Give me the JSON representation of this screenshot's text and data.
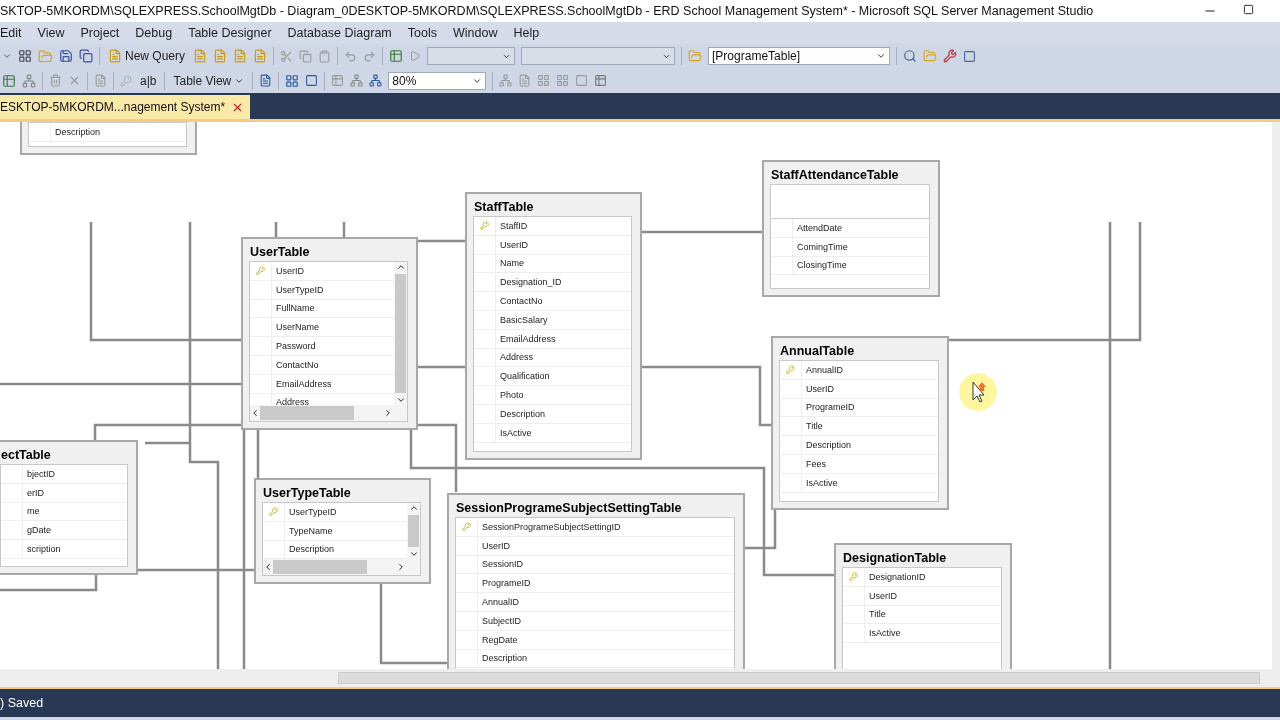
{
  "window": {
    "title": "SKTOP-5MKORDM\\SQLEXPRESS.SchoolMgtDb - Diagram_0DESKTOP-5MKORDM\\SQLEXPRESS.SchoolMgtDb - ERD School Management System* - Microsoft SQL Server Management Studio"
  },
  "menu": [
    "Edit",
    "View",
    "Project",
    "Debug",
    "Table Designer",
    "Database Diagram",
    "Tools",
    "Window",
    "Help"
  ],
  "toolbar": {
    "new_query": "New Query",
    "object_combo": "[ProgrameTable]"
  },
  "designer_toolbar": {
    "rename_glyph": "a|b",
    "table_view": "Table View",
    "zoom": "80%"
  },
  "tabs": [
    {
      "label": "ESKTOP-5MKORDM...nagement System*",
      "selected": true
    }
  ],
  "tables": [
    {
      "rows": [
        {
          "name": "Description",
          "pk": false
        }
      ],
      "scrollbars": false
    },
    {
      "name": "UserTable",
      "rows": [
        {
          "name": "UserID",
          "pk": true
        },
        {
          "name": "UserTypeID",
          "pk": false
        },
        {
          "name": "FullName",
          "pk": false
        },
        {
          "name": "UserName",
          "pk": false
        },
        {
          "name": "Password",
          "pk": false
        },
        {
          "name": "ContactNo",
          "pk": false
        },
        {
          "name": "EmailAddress",
          "pk": false
        },
        {
          "name": "Address",
          "pk": false
        }
      ],
      "scrollbars": true
    },
    {
      "name": "StaffTable",
      "rows": [
        {
          "name": "StaffID",
          "pk": true
        },
        {
          "name": "UserID",
          "pk": false
        },
        {
          "name": "Name",
          "pk": false
        },
        {
          "name": "Designation_ID",
          "pk": false
        },
        {
          "name": "ContactNo",
          "pk": false
        },
        {
          "name": "BasicSalary",
          "pk": false
        },
        {
          "name": "EmailAddress",
          "pk": false
        },
        {
          "name": "Address",
          "pk": false
        },
        {
          "name": "Qualification",
          "pk": false
        },
        {
          "name": "Photo",
          "pk": false
        },
        {
          "name": "Description",
          "pk": false
        },
        {
          "name": "IsActive",
          "pk": false
        }
      ],
      "scrollbars": false
    },
    {
      "name": "StaffAttendanceTable",
      "rows": [
        {
          "name": "AttendDate",
          "pk": false
        },
        {
          "name": "ComingTime",
          "pk": false
        },
        {
          "name": "ClosingTime",
          "pk": false
        }
      ],
      "scrollbars": false
    },
    {
      "name": "AnnualTable",
      "rows": [
        {
          "name": "AnnualID",
          "pk": true
        },
        {
          "name": "UserID",
          "pk": false
        },
        {
          "name": "ProgrameID",
          "pk": false
        },
        {
          "name": "Title",
          "pk": false
        },
        {
          "name": "Description",
          "pk": false
        },
        {
          "name": "Fees",
          "pk": false
        },
        {
          "name": "IsActive",
          "pk": false
        }
      ],
      "scrollbars": false
    },
    {
      "name": "ectTable",
      "rows": [
        {
          "name": "bjectID",
          "pk": false
        },
        {
          "name": "erID",
          "pk": false
        },
        {
          "name": "me",
          "pk": false
        },
        {
          "name": "gDate",
          "pk": false
        },
        {
          "name": "scription",
          "pk": false
        }
      ],
      "scrollbars": false
    },
    {
      "name": "UserTypeTable",
      "rows": [
        {
          "name": "UserTypeID",
          "pk": true
        },
        {
          "name": "TypeName",
          "pk": false
        },
        {
          "name": "Description",
          "pk": false
        }
      ],
      "scrollbars": true
    },
    {
      "name": "SessionProgrameSubjectSettingTable",
      "rows": [
        {
          "name": "SessionProgrameSubjectSettingID",
          "pk": true
        },
        {
          "name": "UserID",
          "pk": false
        },
        {
          "name": "SessionID",
          "pk": false
        },
        {
          "name": "ProgrameID",
          "pk": false
        },
        {
          "name": "AnnualID",
          "pk": false
        },
        {
          "name": "SubjectID",
          "pk": false
        },
        {
          "name": "RegDate",
          "pk": false
        },
        {
          "name": "Description",
          "pk": false
        }
      ],
      "scrollbars": false
    },
    {
      "name": "DesignationTable",
      "rows": [
        {
          "name": "DesignationID",
          "pk": true
        },
        {
          "name": "UserID",
          "pk": false
        },
        {
          "name": "Title",
          "pk": false
        },
        {
          "name": "IsActive",
          "pk": false
        }
      ],
      "scrollbars": false
    }
  ],
  "status_bar": {
    "text": ") Saved"
  }
}
